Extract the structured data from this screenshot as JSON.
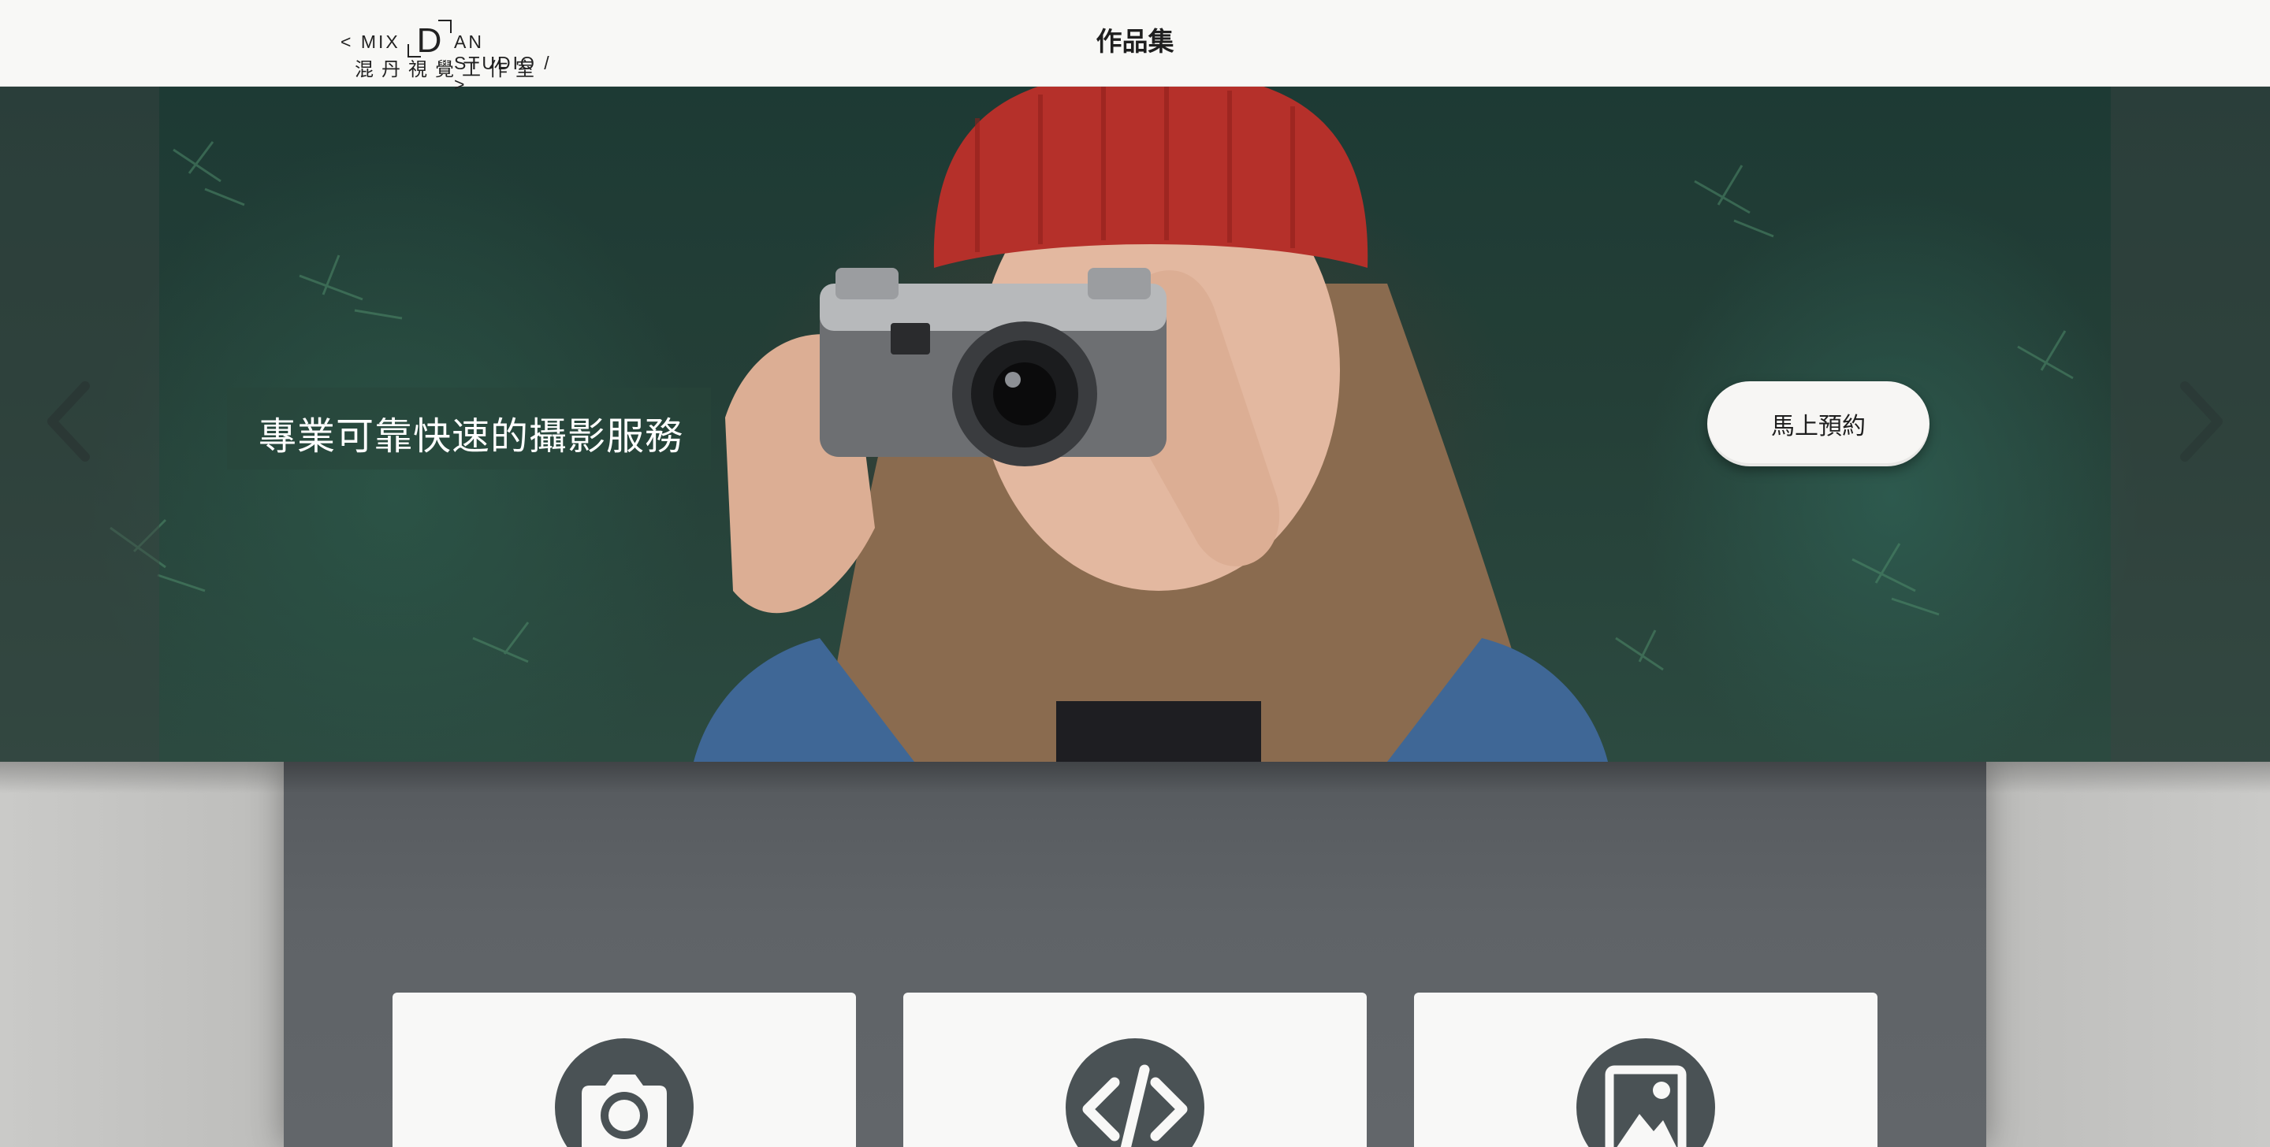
{
  "header": {
    "logo": {
      "left_text": "< MIX",
      "letter": "D",
      "right_text": "AN STUDIO / >",
      "subtitle": "混丹視覺工作室"
    },
    "title": "作品集"
  },
  "hero": {
    "caption": "專業可靠快速的攝影服務",
    "book_button": "馬上預約",
    "prev_icon": "chevron-left-icon",
    "next_icon": "chevron-right-icon"
  },
  "services": [
    {
      "icon": "camera-icon"
    },
    {
      "icon": "code-icon"
    },
    {
      "icon": "image-icon"
    }
  ],
  "colors": {
    "header_bg": "#f8f8f6",
    "panel_bg": "#5f6367",
    "icon_circle": "#4a5255",
    "card_bg": "#f8f8f7",
    "hat_red": "#b5302a"
  }
}
